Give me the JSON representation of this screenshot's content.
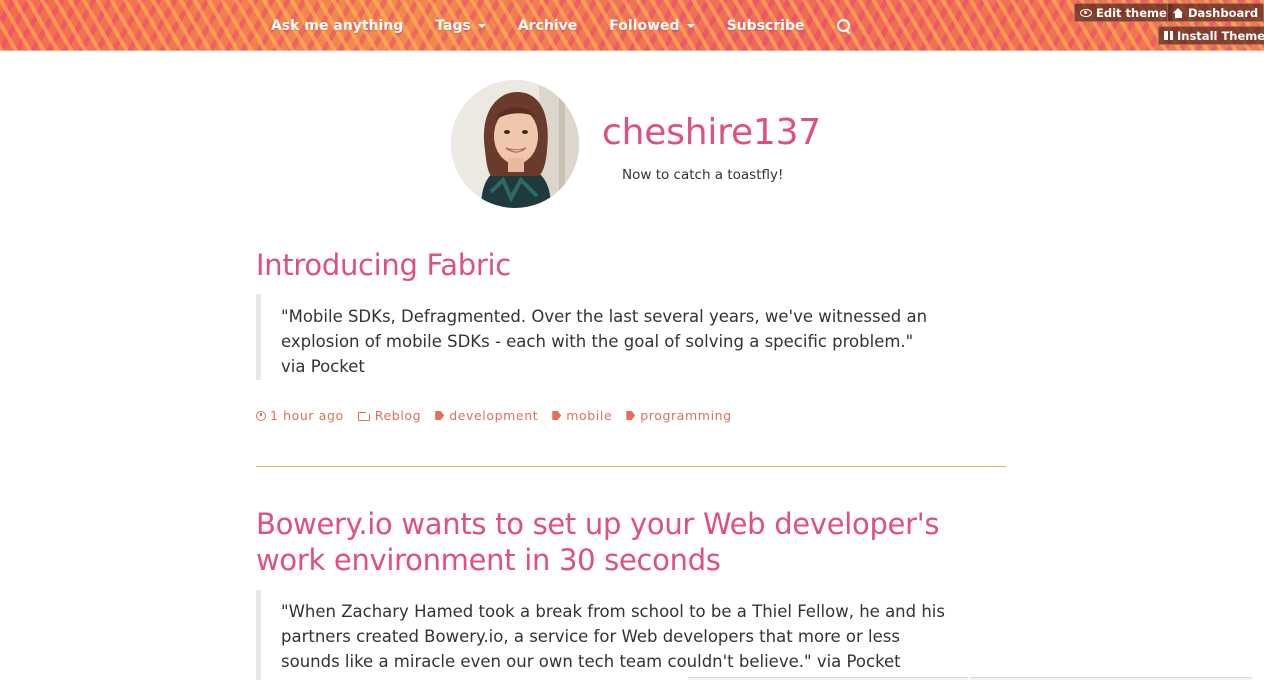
{
  "nav": {
    "items": [
      {
        "label": "Ask me anything",
        "has_caret": false
      },
      {
        "label": "Tags",
        "has_caret": true
      },
      {
        "label": "Archive",
        "has_caret": false
      },
      {
        "label": "Followed",
        "has_caret": true
      },
      {
        "label": "Subscribe",
        "has_caret": false
      }
    ],
    "search_icon": "search-icon"
  },
  "controls": {
    "edit_theme": "Edit theme",
    "dashboard": "Dashboard",
    "install_theme": "Install Theme"
  },
  "blog": {
    "title": "cheshire137",
    "description": "Now to catch a toastfly!"
  },
  "posts": [
    {
      "title": "Introducing Fabric",
      "quote_lines": [
        "\"Mobile SDKs, Defragmented. Over the last several years, we've witnessed an",
        "explosion of mobile SDKs - each with the goal of solving a specific problem.\"",
        "via Pocket"
      ],
      "time": "1 hour ago",
      "reblog": "Reblog",
      "tags": [
        "development",
        "mobile",
        "programming"
      ]
    },
    {
      "title_lines": [
        "Bowery.io wants to set up your Web developer's",
        "work environment in 30 seconds"
      ],
      "quote_lines": [
        "\"When Zachary Hamed took a break from school to be a Thiel Fellow, he and his",
        "partners created Bowery.io, a service for Web developers that more or less",
        "sounds like a miracle even our own tech team couldn't believe.\" via Pocket"
      ]
    }
  ],
  "colors": {
    "accent_pink": "#e0507f",
    "meta_orange": "#e0705a",
    "divider_gold": "#e0b55a",
    "header_orange": "#f0704f"
  }
}
